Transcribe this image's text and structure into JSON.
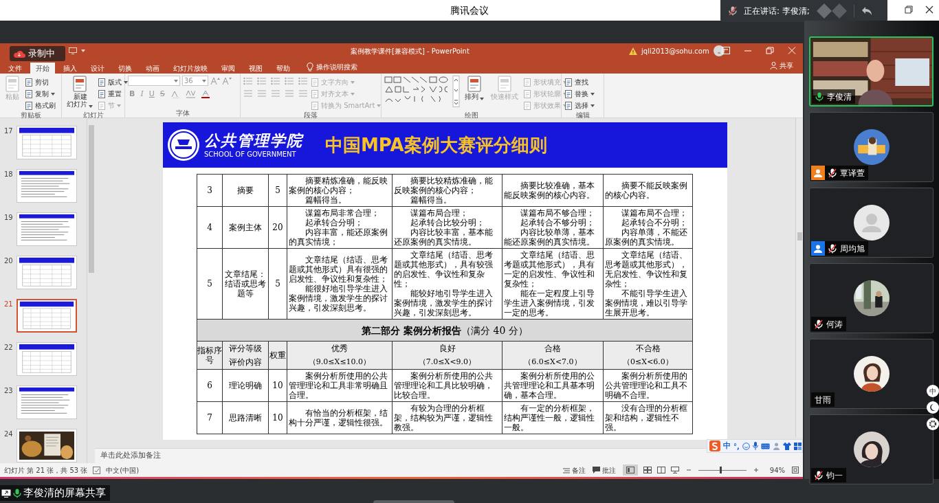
{
  "app_title": "腾讯会议",
  "speaking": {
    "label": "正在讲话: 李俊清;"
  },
  "ppt": {
    "title": "案例教学课件[兼容模式] - PowerPoint",
    "account": "jqli2013@sohu.com",
    "recording": "录制中",
    "tabs": [
      {
        "label": "文件",
        "selected": false
      },
      {
        "label": "开始",
        "selected": true
      },
      {
        "label": "插入",
        "selected": false
      },
      {
        "label": "设计",
        "selected": false
      },
      {
        "label": "切换",
        "selected": false
      },
      {
        "label": "动画",
        "selected": false
      },
      {
        "label": "幻灯片放映",
        "selected": false
      },
      {
        "label": "审阅",
        "selected": false
      },
      {
        "label": "视图",
        "selected": false
      },
      {
        "label": "帮助",
        "selected": false
      }
    ],
    "search_hint": "操作说明搜索",
    "share": "共享",
    "ribbon": [
      {
        "kind": "clipboard",
        "label": "剪贴板",
        "items": [
          {
            "kind": "large",
            "label": "粘贴",
            "disabled": true
          },
          {
            "kind": "small",
            "label": "剪切",
            "disabled": false
          },
          {
            "kind": "small",
            "label": "复制",
            "disabled": false,
            "caret": true
          },
          {
            "kind": "small",
            "label": "格式刷",
            "disabled": false
          }
        ]
      },
      {
        "kind": "slides",
        "label": "幻灯片",
        "items": [
          {
            "kind": "large",
            "label": "新建幻灯片",
            "disabled": false,
            "caret": true
          },
          {
            "kind": "small",
            "label": "版式",
            "disabled": false,
            "caret": true
          },
          {
            "kind": "small",
            "label": "重置",
            "disabled": false
          },
          {
            "kind": "small",
            "label": "节",
            "disabled": true,
            "caret": true
          }
        ]
      },
      {
        "kind": "font",
        "label": "字体",
        "size": "36",
        "formats": [
          "B",
          "I",
          "U",
          "S"
        ]
      },
      {
        "kind": "paragraph",
        "label": "段落",
        "items": [
          {
            "kind": "small",
            "label": "文字方向",
            "disabled": true,
            "caret": true
          },
          {
            "kind": "small",
            "label": "对齐文本",
            "disabled": true,
            "caret": true
          },
          {
            "kind": "small",
            "label": "转换为 SmartArt",
            "disabled": true,
            "caret": true
          }
        ]
      },
      {
        "kind": "drawing",
        "label": "绘图",
        "items": [
          {
            "kind": "large",
            "label": "排列",
            "disabled": false,
            "caret": true
          },
          {
            "kind": "large",
            "label": "快速样式",
            "disabled": true
          },
          {
            "kind": "small",
            "label": "形状填充",
            "disabled": true,
            "caret": true
          },
          {
            "kind": "small",
            "label": "形状轮廓",
            "disabled": true,
            "caret": true
          },
          {
            "kind": "small",
            "label": "形状效果",
            "disabled": true,
            "caret": true
          }
        ]
      },
      {
        "kind": "editing",
        "label": "编辑",
        "items": [
          {
            "kind": "small",
            "label": "查找",
            "disabled": false
          },
          {
            "kind": "small",
            "label": "替换",
            "disabled": false,
            "caret": true
          },
          {
            "kind": "small",
            "label": "选择",
            "disabled": false,
            "caret": true
          }
        ]
      }
    ],
    "thumbnails": [
      {
        "number": "17",
        "kind": "table",
        "selected": false
      },
      {
        "number": "18",
        "kind": "text",
        "selected": false
      },
      {
        "number": "19",
        "kind": "text",
        "selected": false
      },
      {
        "number": "20",
        "kind": "table",
        "selected": false
      },
      {
        "number": "21",
        "kind": "table",
        "selected": true
      },
      {
        "number": "22",
        "kind": "table",
        "selected": false
      },
      {
        "number": "23",
        "kind": "text",
        "selected": false
      },
      {
        "number": "24",
        "kind": "picture",
        "selected": false
      }
    ],
    "slide": {
      "school_name": "公共管理学院",
      "school_english": "SCHOOL OF GOVERNMENT",
      "title": "中国MPA案例大赛评分细则",
      "rows": [
        {
          "kind": "item",
          "number": "3",
          "criterion": "摘要",
          "weight": "5",
          "grades": [
            [
              "摘要精炼准确，能反映案例的核心内容；",
              "篇幅得当。"
            ],
            [
              "摘要比较精炼准确，能反映案例的核心内容；",
              "篇幅得当。"
            ],
            [
              "摘要比较准确，基本能反映案例的核心内容。"
            ],
            [
              "摘要不能反映案例的核心内容。"
            ]
          ]
        },
        {
          "kind": "item",
          "number": "4",
          "criterion": "案例主体",
          "weight": "20",
          "grades": [
            [
              "谋篇布局非常合理；",
              "起承转合分明；",
              "内容丰富，能还原案例的真实情境；"
            ],
            [
              "谋篇布局合理；",
              "起承转合比较分明；",
              "内容比较丰富，基本能还原案例的真实情境。"
            ],
            [
              "谋篇布局不够合理；",
              "起承转合不够分明；",
              "内容比较单薄，基本能还原案例的真实情境。"
            ],
            [
              "谋篇布局不合理；",
              "起承转合不分明；",
              "内容单薄，不能还原案例的真实情境。"
            ]
          ]
        },
        {
          "kind": "item",
          "number": "5",
          "criterion": "文章结尾：结语或思考题等",
          "weight": "5",
          "grades": [
            [
              "文章结尾（结语、思考题或其他形式）具有很强的启发性、争议性和复杂性；",
              "能很好地引导学生进入案例情境，激发学生的探讨兴趣，引发深刻思考。"
            ],
            [
              "文章结尾（结语、思考题或其他形式），具有较强的启发性、争议性和复杂性；",
              "能较好地引导学生进入案例情境，激发学生的探讨兴趣，引发深刻思考。"
            ],
            [
              "文章结尾（结语、思考题或其他形式），具有一定的启发性、争议性和复杂性；",
              "能在一定程度上引导学生进入案例情境，引发一定的思考。"
            ],
            [
              "文章结尾（结语、思考题或其他形式），无启发性、争议性和复杂性；",
              "不能引导学生进入案例情境，难以引导学生展开思考。"
            ]
          ]
        },
        {
          "kind": "section",
          "text": "**第二部分  案例分析报告**（满分 40 分）"
        },
        {
          "kind": "header",
          "number": "指标序号",
          "criterion": [
            "评分等级",
            "评价内容"
          ],
          "weight": "权重",
          "grades": [
            {
              "name": "优秀",
              "range": "（9.0≤X≤10.0）"
            },
            {
              "name": "良好",
              "range": "（7.0≤X<9.0）"
            },
            {
              "name": "合格",
              "range": "（6.0≤X<7.0）"
            },
            {
              "name": "不合格",
              "range": "（0≤X<6.0）"
            }
          ]
        },
        {
          "kind": "item",
          "number": "6",
          "criterion": "理论明确",
          "weight": "10",
          "grades": [
            [
              "案例分析所使用的公共管理理论和工具非常明确且合理。"
            ],
            [
              "案例分析所使用的公共管理理论和工具比较明确，比较合理。"
            ],
            [
              "案例分析所使用的公共管理理论和工具基本明确，基本合理。"
            ],
            [
              "案例分析所使用的公共管理理论和工具不明确不合理。"
            ]
          ]
        },
        {
          "kind": "item",
          "number": "7",
          "criterion": "思路清晰",
          "weight": "10",
          "grades": [
            [
              "有恰当的分析框架，结构十分严谨，逻辑性很强。"
            ],
            [
              "有较为合理的分析框架，结构较为严谨，逻辑性教强。"
            ],
            [
              "有一定的分析框架，结构严谨性一般，逻辑性一般。"
            ],
            [
              "没有合理的分析框架和结构，逻辑性不强。"
            ]
          ]
        }
      ]
    },
    "notes_placeholder": "单击此处添加备注",
    "status": {
      "slide_info": "幻灯片 第 21 张，共 53 张",
      "language": "中文(中国)",
      "notes": "备注",
      "comments": "批注",
      "zoom": "94%",
      "level": 0.46
    }
  },
  "ime": {
    "mode": "中",
    "punct": "°,"
  },
  "side_tool_label": "中",
  "share_label": "李俊清的屏幕共享",
  "participants": [
    {
      "name": "李俊清",
      "kind": "video",
      "mic_shown": true,
      "muted": false,
      "active": true
    },
    {
      "name": "覃译萱",
      "mic_shown": true,
      "muted": true,
      "active": false,
      "color": "#f27f1e"
    },
    {
      "name": "周均旭",
      "kind": "default",
      "mic_shown": true,
      "muted": true,
      "active": false,
      "color": "#1a73e8"
    },
    {
      "name": "何涛",
      "mic_shown": true,
      "muted": true,
      "active": false
    },
    {
      "name": "甘雨",
      "mic_shown": false,
      "active": false
    },
    {
      "name": "钧一",
      "mic_shown": true,
      "muted": true,
      "active": false
    }
  ]
}
